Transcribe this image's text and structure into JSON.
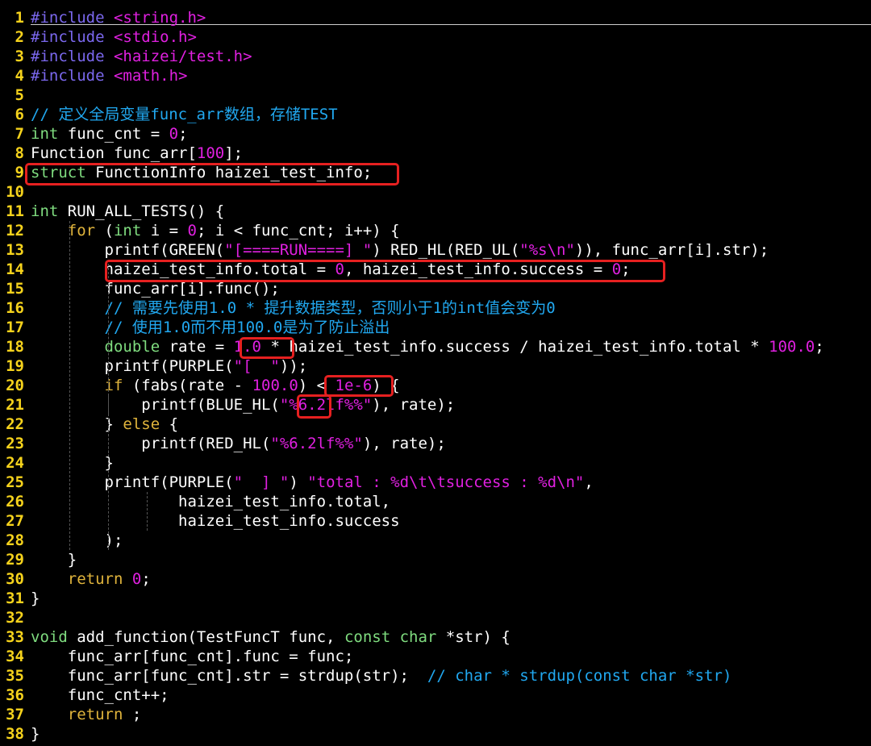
{
  "editor": {
    "lines": [
      [
        [
          "pp",
          "#include "
        ],
        [
          "inc",
          "<string.h>"
        ]
      ],
      [
        [
          "pp",
          "#include "
        ],
        [
          "inc",
          "<stdio.h>"
        ]
      ],
      [
        [
          "pp",
          "#include "
        ],
        [
          "inc",
          "<haizei/test.h>"
        ]
      ],
      [
        [
          "pp",
          "#include "
        ],
        [
          "inc",
          "<math.h>"
        ]
      ],
      [],
      [
        [
          "cm",
          "// 定义全局变量func_arr数组，存储TEST"
        ]
      ],
      [
        [
          "kw",
          "int"
        ],
        [
          "txt",
          " func_cnt = "
        ],
        [
          "num",
          "0"
        ],
        [
          "txt",
          ";"
        ]
      ],
      [
        [
          "txt",
          "Function func_arr["
        ],
        [
          "num",
          "100"
        ],
        [
          "txt",
          "];"
        ]
      ],
      [
        [
          "kw",
          "struct"
        ],
        [
          "txt",
          " FunctionInfo haizei_test_info;"
        ]
      ],
      [],
      [
        [
          "kw",
          "int"
        ],
        [
          "txt",
          " RUN_ALL_TESTS() {"
        ]
      ],
      [
        [
          "txt",
          "    "
        ],
        [
          "ctl",
          "for"
        ],
        [
          "txt",
          " ("
        ],
        [
          "kw",
          "int"
        ],
        [
          "txt",
          " i = "
        ],
        [
          "num",
          "0"
        ],
        [
          "txt",
          "; i < func_cnt; i++) {"
        ]
      ],
      [
        [
          "txt",
          "        printf(GREEN("
        ],
        [
          "str",
          "\"[====RUN====] \""
        ],
        [
          "txt",
          ") RED_HL(RED_UL("
        ],
        [
          "str",
          "\"%s\\n\""
        ],
        [
          "txt",
          ")), func_arr[i].str);"
        ]
      ],
      [
        [
          "txt",
          "        haizei_test_info.total = "
        ],
        [
          "num",
          "0"
        ],
        [
          "txt",
          ", haizei_test_info.success = "
        ],
        [
          "num",
          "0"
        ],
        [
          "txt",
          ";"
        ]
      ],
      [
        [
          "txt",
          "        func_arr[i].func();"
        ]
      ],
      [
        [
          "txt",
          "        "
        ],
        [
          "cm",
          "// 需要先使用1.0 * 提升数据类型，否则小于1的int值会变为0"
        ]
      ],
      [
        [
          "txt",
          "        "
        ],
        [
          "cm",
          "// 使用1.0而不用100.0是为了防止溢出"
        ]
      ],
      [
        [
          "txt",
          "        "
        ],
        [
          "kw",
          "double"
        ],
        [
          "txt",
          " rate = "
        ],
        [
          "num",
          "1.0"
        ],
        [
          "txt",
          " * haizei_test_info.success / haizei_test_info.total * "
        ],
        [
          "num",
          "100.0"
        ],
        [
          "txt",
          ";"
        ]
      ],
      [
        [
          "txt",
          "        printf(PURPLE("
        ],
        [
          "str",
          "\"[  \""
        ],
        [
          "txt",
          "));"
        ]
      ],
      [
        [
          "txt",
          "        "
        ],
        [
          "ctl",
          "if"
        ],
        [
          "txt",
          " (fabs(rate - "
        ],
        [
          "num",
          "100.0"
        ],
        [
          "txt",
          ") < "
        ],
        [
          "num",
          "1e-6"
        ],
        [
          "txt",
          ") {"
        ]
      ],
      [
        [
          "txt",
          "            printf(BLUE_HL("
        ],
        [
          "str",
          "\"%6.2lf%%\""
        ],
        [
          "txt",
          "), rate);"
        ]
      ],
      [
        [
          "txt",
          "        } "
        ],
        [
          "ctl",
          "else"
        ],
        [
          "txt",
          " {"
        ]
      ],
      [
        [
          "txt",
          "            printf(RED_HL("
        ],
        [
          "str",
          "\"%6.2lf%%\""
        ],
        [
          "txt",
          "), rate);"
        ]
      ],
      [
        [
          "txt",
          "        }"
        ]
      ],
      [
        [
          "txt",
          "        printf(PURPLE("
        ],
        [
          "str",
          "\"  ] \""
        ],
        [
          "txt",
          ") "
        ],
        [
          "str",
          "\"total : %d\\t\\tsuccess : %d\\n\""
        ],
        [
          "txt",
          ","
        ]
      ],
      [
        [
          "txt",
          "                haizei_test_info.total,"
        ]
      ],
      [
        [
          "txt",
          "                haizei_test_info.success"
        ]
      ],
      [
        [
          "txt",
          "        );"
        ]
      ],
      [
        [
          "txt",
          "    }"
        ]
      ],
      [
        [
          "txt",
          "    "
        ],
        [
          "ctl",
          "return"
        ],
        [
          "txt",
          " "
        ],
        [
          "num",
          "0"
        ],
        [
          "txt",
          ";"
        ]
      ],
      [
        [
          "txt",
          "}"
        ]
      ],
      [],
      [
        [
          "kw",
          "void"
        ],
        [
          "txt",
          " add_function(TestFuncT func, "
        ],
        [
          "kw",
          "const"
        ],
        [
          "txt",
          " "
        ],
        [
          "kw",
          "char"
        ],
        [
          "txt",
          " *str) {"
        ]
      ],
      [
        [
          "txt",
          "    func_arr[func_cnt].func = func;"
        ]
      ],
      [
        [
          "txt",
          "    func_arr[func_cnt].str = strdup(str);  "
        ],
        [
          "cm",
          "// char * strdup(const char *str)"
        ]
      ],
      [
        [
          "txt",
          "    func_cnt++;"
        ]
      ],
      [
        [
          "txt",
          "    "
        ],
        [
          "ctl",
          "return"
        ],
        [
          "txt",
          " ;"
        ]
      ],
      [
        [
          "txt",
          "}"
        ]
      ]
    ]
  }
}
